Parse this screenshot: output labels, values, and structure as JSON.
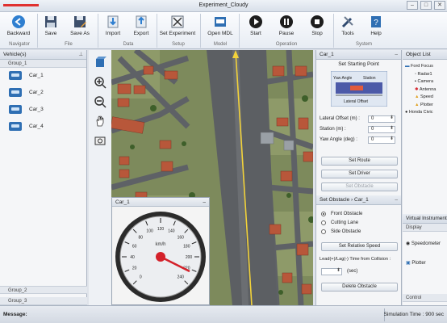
{
  "window": {
    "title": "Experiment_Cloudy",
    "controls": [
      "–",
      "□",
      "✕"
    ]
  },
  "ribbon": {
    "buttons": [
      {
        "key": "backward",
        "label": "Backward",
        "icon": "back-arrow-icon"
      },
      {
        "key": "save",
        "label": "Save",
        "icon": "floppy-icon"
      },
      {
        "key": "save_as",
        "label": "Save As",
        "icon": "floppy-pencil-icon"
      },
      {
        "key": "import",
        "label": "Import",
        "icon": "import-icon"
      },
      {
        "key": "export",
        "label": "Export",
        "icon": "export-icon"
      },
      {
        "key": "set_experiment",
        "label": "Set Experiment",
        "icon": "settings-grid-icon"
      },
      {
        "key": "open_mdl",
        "label": "Open MDL",
        "icon": "mdl-icon"
      },
      {
        "key": "start",
        "label": "Start",
        "icon": "play-icon"
      },
      {
        "key": "pause",
        "label": "Pause",
        "icon": "pause-icon"
      },
      {
        "key": "stop",
        "label": "Stop",
        "icon": "stop-icon"
      },
      {
        "key": "tools",
        "label": "Tools",
        "icon": "tools-icon"
      },
      {
        "key": "help",
        "label": "Help",
        "icon": "help-icon"
      }
    ],
    "groups": [
      "Navigator",
      "File",
      "Data",
      "Setup",
      "Model",
      "Operation",
      "System"
    ]
  },
  "vehicles": {
    "title": "Vehicle(s)",
    "group1": "Group_1",
    "cars": [
      "Car_1",
      "Car_2",
      "Car_3",
      "Car_4"
    ],
    "group2": "Group_2",
    "group3": "Group_3"
  },
  "inset": {
    "title": "Car_1",
    "speed_unit": "km/h",
    "dial_labels": [
      "0",
      "20",
      "40",
      "60",
      "80",
      "100",
      "120",
      "140",
      "160",
      "180",
      "200",
      "220",
      "240"
    ]
  },
  "setup_panel": {
    "title": "Car_1",
    "starting_point": "Set Starting Point",
    "diagram_labels": {
      "yaw": "Yaw Angle",
      "station": "Station",
      "lateral": "Lateral Offset"
    },
    "lateral_offset_label": "Lateral Offset (m) :",
    "lateral_offset_value": "0",
    "station_label": "Station (m) :",
    "station_value": "0",
    "yaw_label": "Yaw Angle (deg) :",
    "yaw_value": "0",
    "set_route": "Set Route",
    "set_driver": "Set Driver",
    "set_obstacle": "Set Obstacle",
    "obstacle_header": "Set Obstacle",
    "obstacle_sep": "›",
    "obstacle_target": "Car_1",
    "obstacle_options": [
      "Front Obstacle",
      "Cutting Lane",
      "Side Obstacle"
    ],
    "relative_speed": "Set Relative Speed",
    "lead_lag_text": "Lead(+)/Lag(-) Time from Collision :",
    "sec_unit": "(sec)",
    "delete_obstacle": "Delete Obstacle"
  },
  "object_list": {
    "title": "Object List",
    "items": [
      "Ford Focus",
      "Radar1",
      "Camera",
      "Antenna",
      "Speed",
      "Plotter",
      "Honda Civic"
    ],
    "vi_title": "Virtual Instrument",
    "vi_display": "Display",
    "vi_items": [
      "Speedometer",
      "Plotter"
    ],
    "control": "Control"
  },
  "status": {
    "message_label": "Message:",
    "simulation_time": "Simulation Time : 900 sec"
  },
  "colors": {
    "accent": "#2f6fb3",
    "road": "#5c5f63",
    "grass": "#7c8a5e",
    "roof": "#b8573a",
    "lane": "#f2d23a",
    "needle": "#d4212a"
  }
}
